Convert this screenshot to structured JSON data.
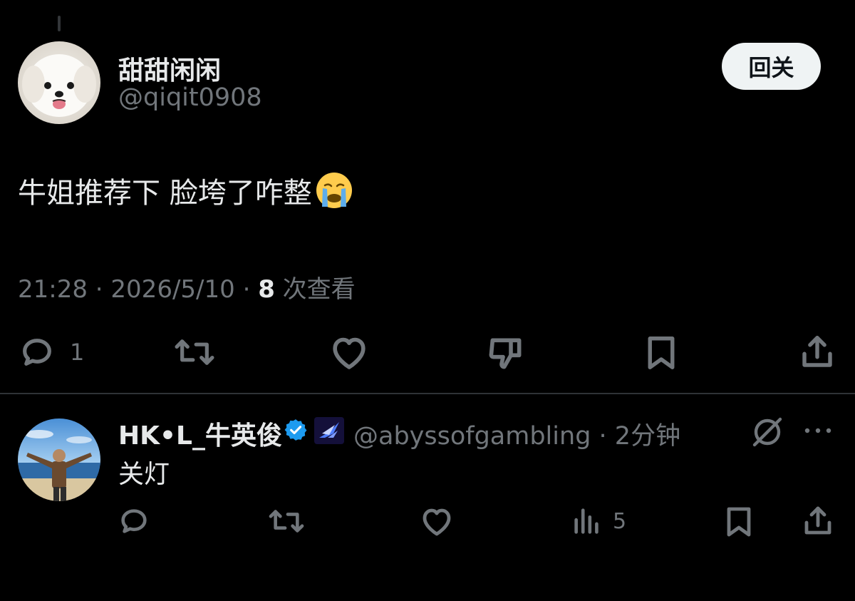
{
  "main_tweet": {
    "display_name": "甜甜闲闲",
    "handle": "@qiqit0908",
    "follow_back_label": "回关",
    "text": "牛姐推荐下 脸垮了咋整",
    "text_emoji": "😭",
    "time": "21:28",
    "sep1": " · ",
    "date": "2026/5/10",
    "sep2": " · ",
    "views_count": "8",
    "views_label": " 次查看",
    "reply_count": "1",
    "icons": [
      "reply-icon",
      "retweet-icon",
      "like-icon",
      "dislike-icon",
      "bookmark-icon",
      "share-icon"
    ]
  },
  "reply": {
    "display_name": "HK•L_牛英俊",
    "handle": "@abyssofgambling",
    "time_sep": " · ",
    "time_ago": "2分钟",
    "text": "关灯",
    "views_count": "5",
    "icons": [
      "reply-icon",
      "retweet-icon",
      "like-icon",
      "views-icon",
      "bookmark-icon",
      "share-icon"
    ]
  },
  "colors": {
    "background": "#000000",
    "text_primary": "#e7e9ea",
    "text_secondary": "#71767b",
    "verified_blue": "#1d9bf0",
    "divider": "#2f3336"
  }
}
